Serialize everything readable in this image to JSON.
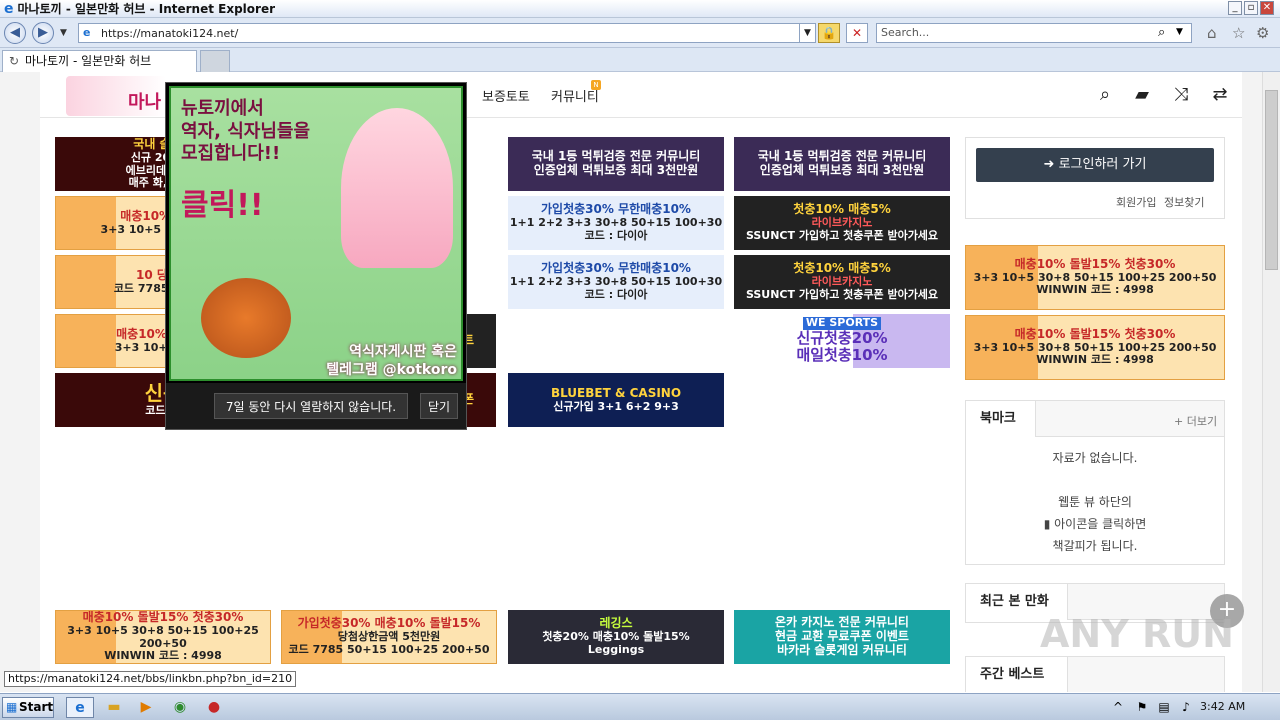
{
  "window": {
    "title": "마나토끼 - 일본만화 허브 - Internet Explorer",
    "minimize": "_",
    "maximize": "▫",
    "close": "✕"
  },
  "browser": {
    "url": "https://manatoki124.net/",
    "search_placeholder": "Search...",
    "tab_title": "마나토끼 - 일본만화 허브"
  },
  "site": {
    "logo_text": "마나",
    "nav": {
      "item1": "보증토토",
      "item2": "커뮤니티",
      "new_badge": "N"
    },
    "icons": [
      "search-icon",
      "folder-icon",
      "shuffle-icon",
      "swap-icon"
    ]
  },
  "banners": {
    "b1": {
      "l1": "국내 슬롯개",
      "l2": "신규 20% 최",
      "l3": "에브리데이 잭팟",
      "l4": "매주 화,금요일"
    },
    "b2": {
      "l1": "매충10% 돌발1",
      "l2": "3+3 10+5 30+8 50+"
    },
    "b3": {
      "l1": "10 당첨상",
      "l2": "코드 7785 50+15"
    },
    "b4": {
      "l1": "매충10% 돌발15",
      "l2": "3+3 10+5 30+8"
    },
    "b5": {
      "l1": "신규",
      "l2": "코드:M"
    },
    "c1": {
      "l1": "국내 1등 먹튀검증 전문 커뮤니티",
      "l2": "인증업체 먹튀보증 최대 3천만원"
    },
    "c2": {
      "l1": "가입첫충30% 무한매충10%",
      "l2": "1+1 2+2 3+3 30+8 50+15 100+30",
      "l3": "코드 : 다이아"
    },
    "c3": {
      "l1": "가입첫충30% 무한매충10%",
      "l2": "1+1 2+2 3+3 30+8 50+15 100+30",
      "l3": "코드 : 다이아"
    },
    "c4": {
      "l1": "BLUEBET & CASINO",
      "l2": "신규가입 3+1 6+2 9+3"
    },
    "d1": {
      "l1": "국내 1등 먹튀검증 전문 커뮤니티",
      "l2": "인증업체 먹튀보증 최대 3천만원"
    },
    "d2": {
      "l1": "첫충10% 매충5%",
      "l2": "라이브카지노",
      "l3": "SSUNCT 가입하고 첫충쿠폰 받아가세요"
    },
    "d3": {
      "l1": "첫충10% 매충5%",
      "l2": "라이브카지노",
      "l3": "SSUNCT 가입하고 첫충쿠폰 받아가세요"
    },
    "d4": {
      "l1": "신규첫충20%",
      "l2": "매일첫충10%",
      "l3": "WE SPORTS"
    },
    "bottom1": {
      "l1": "매충10% 돌발15% 첫충30%",
      "l2": "3+3 10+5 30+8 50+15 100+25 200+50",
      "l3": "WINWIN 코드 : 4998"
    },
    "bottom2": {
      "l1": "가입첫충30% 매충10% 돌발15%",
      "l2": "당첨상한금액 5천만원",
      "l3": "코드 7785 50+15 100+25 200+50"
    },
    "bottom3": {
      "l1": "레깅스",
      "l2": "첫충20% 매충10% 돌발15%",
      "l3": "Leggings"
    },
    "bottom4": {
      "l1": "온카 카지노 전문 커뮤니티",
      "l2": "현금 교환 무료쿠폰 이벤트",
      "l3": "바카라 슬롯게임 커뮤니티"
    },
    "e1": {
      "l1": "이트"
    },
    "e2": {
      "l1": "쿠폰"
    }
  },
  "sidebar": {
    "login_button": "로그인하러 가기",
    "signup": "회원가입",
    "find_info": "정보찾기",
    "side_banner1": {
      "l1": "매충10% 돌발15% 첫충30%",
      "l2": "3+3 10+5 30+8 50+15 100+25 200+50",
      "l3": "WINWIN 코드 : 4998"
    },
    "side_banner2": {
      "l1": "매충10% 돌발15% 첫충30%",
      "l2": "3+3 10+5 30+8 50+15 100+25 200+50",
      "l3": "WINWIN 코드 : 4998"
    },
    "bookmark_tab": "북마크",
    "more": "+ 더보기",
    "no_data": "자료가 없습니다.",
    "hint1": "웹툰 뷰 하단의",
    "hint2": "아이콘을 클릭하면",
    "hint3": "책갈피가 됩니다.",
    "recent_tab": "최근 본 만화",
    "weekly_tab": "주간 베스트"
  },
  "popup": {
    "line1": "뉴토끼에서",
    "line2": "역자, 식자님들을",
    "line3": "모집합니다!!",
    "click": "클릭!!",
    "footer1": "역식자게시판 혹은",
    "footer2": "텔레그램 @kotkoro",
    "dont_show": "7일 동안 다시 열람하지 않습니다.",
    "close": "닫기"
  },
  "status_url": "https://manatoki124.net/bbs/linkbn.php?bn_id=210",
  "taskbar": {
    "start": "Start",
    "clock": "3:42 AM"
  },
  "watermark": "ANY RUN",
  "colors": {
    "login_bg": "#34404e",
    "popup_bg": "#a8e0a0",
    "accent_pink": "#c2185b"
  }
}
